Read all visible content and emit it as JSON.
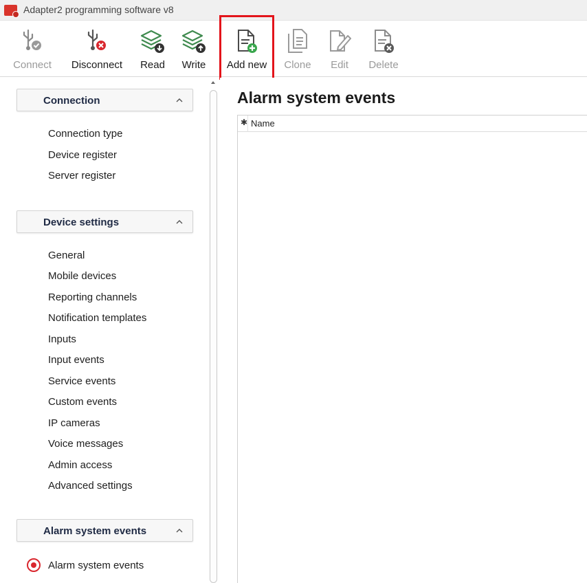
{
  "window": {
    "title": "Adapter2 programming software v8"
  },
  "toolbar": {
    "buttons": [
      {
        "label": "Connect",
        "icon": "usb-check-icon",
        "enabled": false
      },
      {
        "label": "Disconnect",
        "icon": "usb-disconnect-icon",
        "enabled": true
      },
      {
        "label": "Read",
        "icon": "layers-download-icon",
        "enabled": true
      },
      {
        "label": "Write",
        "icon": "layers-upload-icon",
        "enabled": true
      },
      {
        "label": "Add new",
        "icon": "document-add-icon",
        "enabled": true,
        "highlighted": true
      },
      {
        "label": "Clone",
        "icon": "document-copy-icon",
        "enabled": false
      },
      {
        "label": "Edit",
        "icon": "document-edit-icon",
        "enabled": false
      },
      {
        "label": "Delete",
        "icon": "document-delete-icon",
        "enabled": false
      }
    ]
  },
  "sidebar": {
    "sections": [
      {
        "title": "Connection",
        "items": [
          "Connection type",
          "Device register",
          "Server register"
        ]
      },
      {
        "title": "Device settings",
        "items": [
          "General",
          "Mobile devices",
          "Reporting channels",
          "Notification templates",
          "Inputs",
          "Input events",
          "Service events",
          "Custom events",
          "IP cameras",
          "Voice messages",
          "Admin access",
          "Advanced settings"
        ]
      },
      {
        "title": "Alarm system events",
        "items": [
          "Alarm system events"
        ],
        "selected": "Alarm system events"
      }
    ]
  },
  "main": {
    "title": "Alarm system events",
    "grid": {
      "marker": "✱",
      "columns": [
        "Name"
      ],
      "rows": []
    }
  },
  "colors": {
    "highlight_border": "#e3141b",
    "accent_green": "#3aa64d",
    "accent_red": "#d9272e",
    "icon_gray": "#6e6e6e",
    "disabled_text": "#9a9a9a"
  }
}
